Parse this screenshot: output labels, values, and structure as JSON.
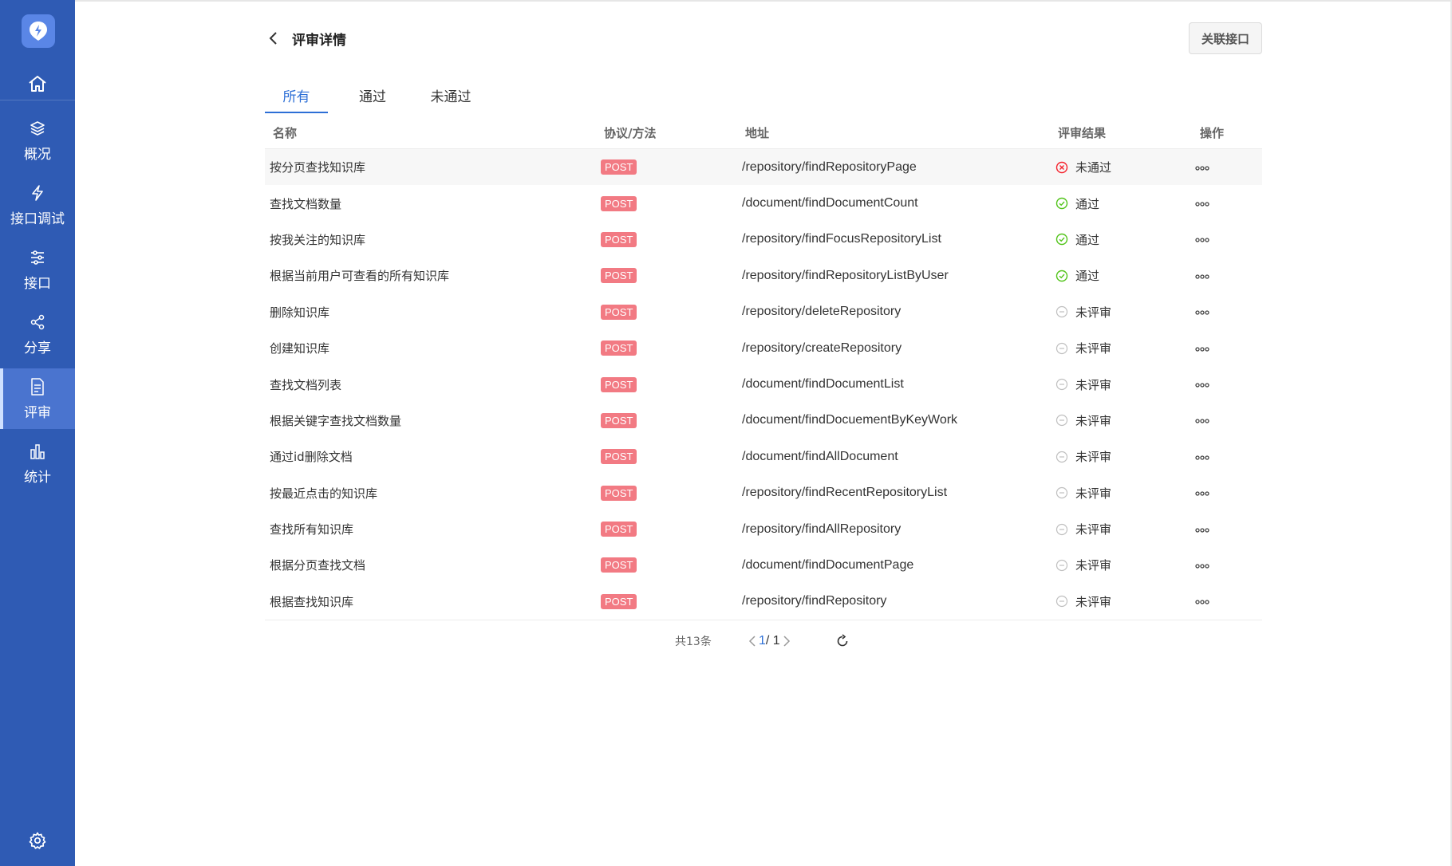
{
  "sidebar": {
    "items": [
      {
        "label": "概况",
        "icon": "layers-icon"
      },
      {
        "label": "接口调试",
        "icon": "lightning-icon"
      },
      {
        "label": "接口",
        "icon": "sliders-icon"
      },
      {
        "label": "分享",
        "icon": "share-icon"
      },
      {
        "label": "评审",
        "icon": "document-icon",
        "active": true
      },
      {
        "label": "统计",
        "icon": "bar-chart-icon"
      }
    ]
  },
  "header": {
    "title": "评审详情",
    "link_button": "关联接口"
  },
  "tabs": [
    {
      "label": "所有",
      "active": true
    },
    {
      "label": "通过"
    },
    {
      "label": "未通过"
    }
  ],
  "table": {
    "columns": [
      "名称",
      "协议/方法",
      "地址",
      "评审结果",
      "操作"
    ],
    "rows": [
      {
        "name": "按分页查找知识库",
        "method": "POST",
        "path": "/repository/findRepositoryPage",
        "result": "未通过",
        "status": "fail"
      },
      {
        "name": "查找文档数量",
        "method": "POST",
        "path": "/document/findDocumentCount",
        "result": "通过",
        "status": "pass"
      },
      {
        "name": "按我关注的知识库",
        "method": "POST",
        "path": "/repository/findFocusRepositoryList",
        "result": "通过",
        "status": "pass"
      },
      {
        "name": "根据当前用户可查看的所有知识库",
        "method": "POST",
        "path": "/repository/findRepositoryListByUser",
        "result": "通过",
        "status": "pass"
      },
      {
        "name": "删除知识库",
        "method": "POST",
        "path": "/repository/deleteRepository",
        "result": "未评审",
        "status": "none"
      },
      {
        "name": "创建知识库",
        "method": "POST",
        "path": "/repository/createRepository",
        "result": "未评审",
        "status": "none"
      },
      {
        "name": "查找文档列表",
        "method": "POST",
        "path": "/document/findDocumentList",
        "result": "未评审",
        "status": "none"
      },
      {
        "name": "根据关键字查找文档数量",
        "method": "POST",
        "path": "/document/findDocuementByKeyWork",
        "result": "未评审",
        "status": "none"
      },
      {
        "name": "通过id删除文档",
        "method": "POST",
        "path": "/document/findAllDocument",
        "result": "未评审",
        "status": "none"
      },
      {
        "name": "按最近点击的知识库",
        "method": "POST",
        "path": "/repository/findRecentRepositoryList",
        "result": "未评审",
        "status": "none"
      },
      {
        "name": "查找所有知识库",
        "method": "POST",
        "path": "/repository/findAllRepository",
        "result": "未评审",
        "status": "none"
      },
      {
        "name": "根据分页查找文档",
        "method": "POST",
        "path": "/document/findDocumentPage",
        "result": "未评审",
        "status": "none"
      },
      {
        "name": "根据查找知识库",
        "method": "POST",
        "path": "/repository/findRepository",
        "result": "未评审",
        "status": "none"
      }
    ]
  },
  "pagination": {
    "total": "共13条",
    "current": "1",
    "pages": "/ 1"
  },
  "colors": {
    "sidebar": "#2f5bb4",
    "accent": "#2d6fd6",
    "post": "#f27a83",
    "pass": "#52c41a",
    "fail": "#f5222d",
    "none": "#bfbfbf"
  }
}
